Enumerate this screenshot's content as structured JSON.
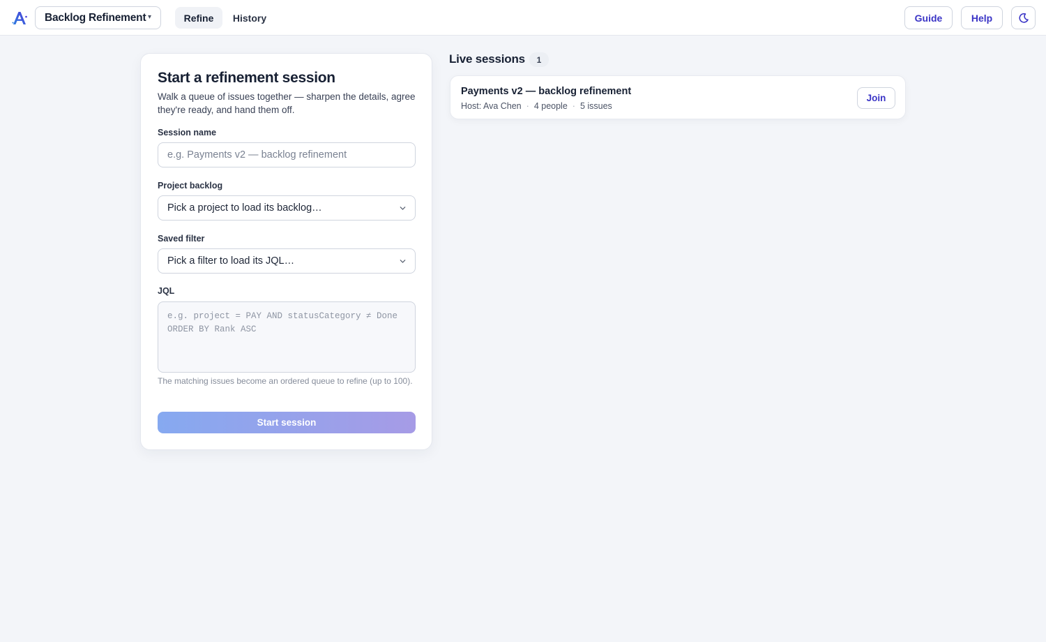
{
  "header": {
    "logo_icon": "brand-a-icon",
    "app_name": "Backlog Refinement",
    "app_caret": "▾",
    "tabs": [
      {
        "label": "Refine",
        "active": true
      },
      {
        "label": "History",
        "active": false
      }
    ],
    "guide_label": "Guide",
    "help_label": "Help",
    "theme_icon": "moon-icon"
  },
  "form": {
    "title": "Start a refinement session",
    "description": "Walk a queue of issues together — sharpen the details, agree they're ready, and hand them off.",
    "session_name": {
      "label": "Session name",
      "placeholder": "e.g. Payments v2 — backlog refinement",
      "value": ""
    },
    "project_backlog": {
      "label": "Project backlog",
      "selected": "Pick a project to load its backlog…",
      "icon": "chevron-down-icon"
    },
    "saved_filter": {
      "label": "Saved filter",
      "selected": "Pick a filter to load its JQL…",
      "icon": "chevron-down-icon"
    },
    "jql": {
      "label": "JQL",
      "placeholder": "e.g. project = PAY AND statusCategory ≠ Done\nORDER BY Rank ASC",
      "value": ""
    },
    "hint": "The matching issues become an ordered queue to refine (up to 100).",
    "start_label": "Start session"
  },
  "live": {
    "title": "Live sessions",
    "count": "1",
    "sessions": [
      {
        "title": "Payments v2 — backlog refinement",
        "host": "Host: Ava Chen",
        "people": "4 people",
        "issues": "5 issues",
        "join_label": "Join"
      }
    ]
  },
  "colors": {
    "accent": "#3b35c6",
    "background": "#f3f5f9",
    "button_gradient_start": "#86a9f0",
    "button_gradient_end": "#a69be6"
  }
}
